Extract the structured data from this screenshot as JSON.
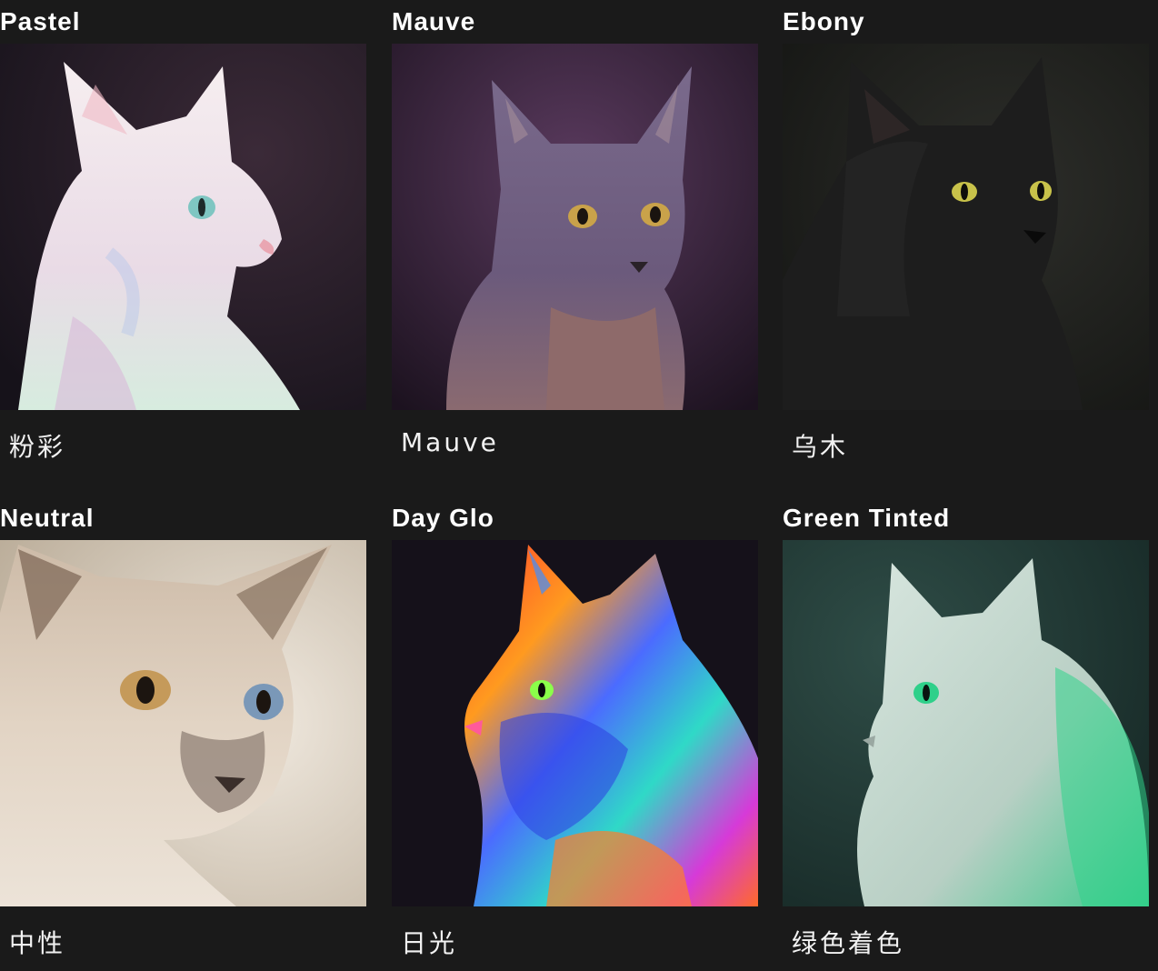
{
  "tiles": [
    {
      "title": "Pastel",
      "caption": "粉彩",
      "image_subject": "white-pastel-cat"
    },
    {
      "title": "Mauve",
      "caption": "Mauve",
      "image_subject": "mauve-sphynx-cat"
    },
    {
      "title": "Ebony",
      "caption": "乌木",
      "image_subject": "black-cat"
    },
    {
      "title": "Neutral",
      "caption": "中性",
      "image_subject": "siamese-cat"
    },
    {
      "title": "Day Glo",
      "caption": "日光",
      "image_subject": "rainbow-neon-cat"
    },
    {
      "title": "Green Tinted",
      "caption": "绿色着色",
      "image_subject": "green-tinted-white-cat"
    }
  ],
  "colors": {
    "background": "#1a1a1a",
    "text": "#ffffff"
  }
}
